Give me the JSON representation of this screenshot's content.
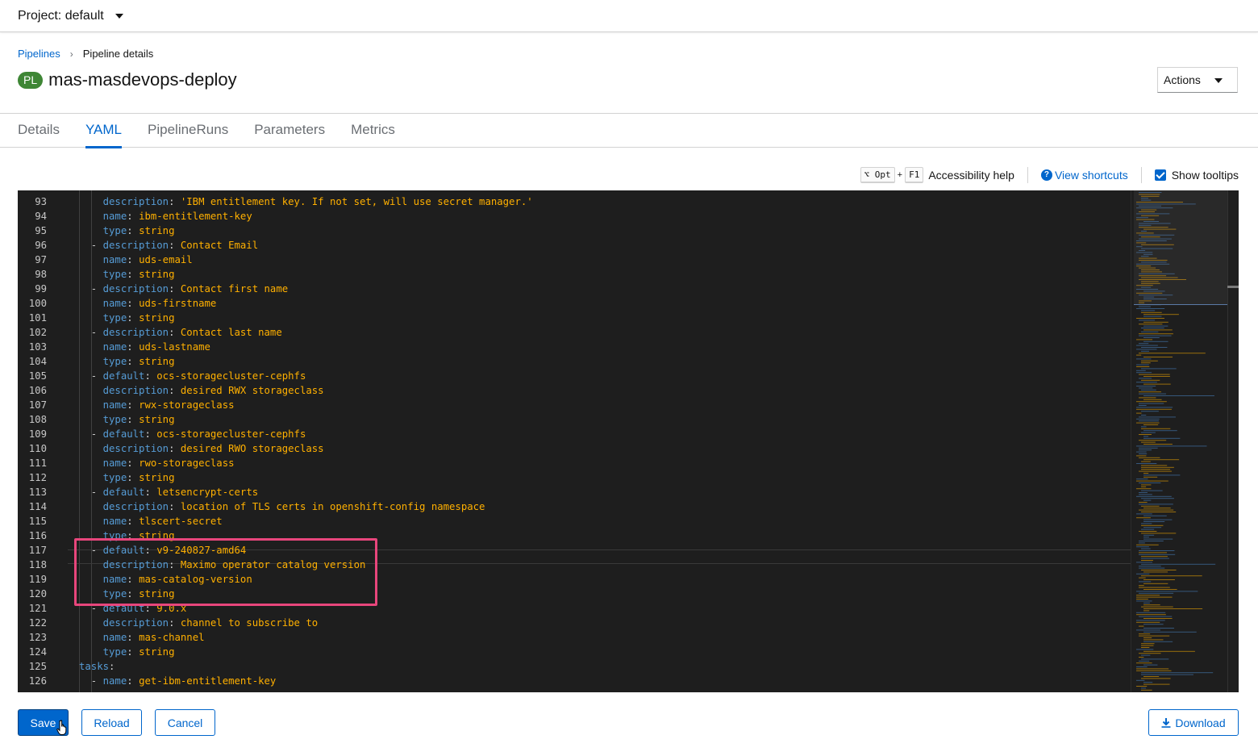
{
  "project": {
    "label": "Project: default"
  },
  "breadcrumb": {
    "parent": "Pipelines",
    "current": "Pipeline details"
  },
  "header": {
    "badge": "PL",
    "title": "mas-masdevops-deploy",
    "actions_label": "Actions"
  },
  "tabs": [
    {
      "label": "Details"
    },
    {
      "label": "YAML",
      "active": true
    },
    {
      "label": "PipelineRuns"
    },
    {
      "label": "Parameters"
    },
    {
      "label": "Metrics"
    }
  ],
  "toolbar": {
    "opt_key": "⌥ Opt",
    "plus": "+",
    "f1_key": "F1",
    "accessibility_help": "Accessibility help",
    "view_shortcuts": "View shortcuts",
    "show_tooltips": "Show tooltips",
    "show_tooltips_checked": true
  },
  "editor": {
    "line_numbers": [
      "93",
      "94",
      "95",
      "96",
      "97",
      "98",
      "99",
      "100",
      "101",
      "102",
      "103",
      "104",
      "105",
      "106",
      "107",
      "108",
      "109",
      "110",
      "111",
      "112",
      "113",
      "114",
      "115",
      "116",
      "117",
      "118",
      "119",
      "120",
      "121",
      "122",
      "123",
      "124",
      "125",
      "126"
    ],
    "lines": [
      {
        "dash": "",
        "key": "description",
        "value": "'IBM entitlement key. If not set, will use secret manager.'"
      },
      {
        "dash": "",
        "key": "name",
        "value": "ibm-entitlement-key"
      },
      {
        "dash": "",
        "key": "type",
        "value": "string"
      },
      {
        "dash": "-",
        "key": "description",
        "value": "Contact Email"
      },
      {
        "dash": "",
        "key": "name",
        "value": "uds-email"
      },
      {
        "dash": "",
        "key": "type",
        "value": "string"
      },
      {
        "dash": "-",
        "key": "description",
        "value": "Contact first name"
      },
      {
        "dash": "",
        "key": "name",
        "value": "uds-firstname"
      },
      {
        "dash": "",
        "key": "type",
        "value": "string"
      },
      {
        "dash": "-",
        "key": "description",
        "value": "Contact last name"
      },
      {
        "dash": "",
        "key": "name",
        "value": "uds-lastname"
      },
      {
        "dash": "",
        "key": "type",
        "value": "string"
      },
      {
        "dash": "-",
        "key": "default",
        "value": "ocs-storagecluster-cephfs"
      },
      {
        "dash": "",
        "key": "description",
        "value": "desired RWX storageclass"
      },
      {
        "dash": "",
        "key": "name",
        "value": "rwx-storageclass"
      },
      {
        "dash": "",
        "key": "type",
        "value": "string"
      },
      {
        "dash": "-",
        "key": "default",
        "value": "ocs-storagecluster-cephfs"
      },
      {
        "dash": "",
        "key": "description",
        "value": "desired RWO storageclass"
      },
      {
        "dash": "",
        "key": "name",
        "value": "rwo-storageclass"
      },
      {
        "dash": "",
        "key": "type",
        "value": "string"
      },
      {
        "dash": "-",
        "key": "default",
        "value": "letsencrypt-certs"
      },
      {
        "dash": "",
        "key": "description",
        "value": "location of TLS certs in openshift-config namespace"
      },
      {
        "dash": "",
        "key": "name",
        "value": "tlscert-secret"
      },
      {
        "dash": "",
        "key": "type",
        "value": "string"
      },
      {
        "dash": "-",
        "key": "default",
        "value": "v9-240827-amd64"
      },
      {
        "dash": "",
        "key": "description",
        "value": "Maximo operator catalog version"
      },
      {
        "dash": "",
        "key": "name",
        "value": "mas-catalog-version"
      },
      {
        "dash": "",
        "key": "type",
        "value": "string"
      },
      {
        "dash": "-",
        "key": "default",
        "value": "9.0.x"
      },
      {
        "dash": "",
        "key": "description",
        "value": "channel to subscribe to"
      },
      {
        "dash": "",
        "key": "name",
        "value": "mas-channel"
      },
      {
        "dash": "",
        "key": "type",
        "value": "string"
      },
      {
        "dash": "",
        "key": "tasks",
        "value": "",
        "top": true
      },
      {
        "dash": "-",
        "key": "name",
        "value": "get-ibm-entitlement-key"
      }
    ]
  },
  "buttons": {
    "save": "Save",
    "reload": "Reload",
    "cancel": "Cancel",
    "download": "Download"
  },
  "colors": {
    "accent": "#0066cc",
    "badge": "#3e8635",
    "highlight": "#e8467c",
    "yaml_key": "#569cd6",
    "yaml_value": "#ffb000"
  },
  "icons": {
    "help": "question-circle-icon",
    "download": "download-icon",
    "breadcrumb_sep": "chevron-right-icon"
  }
}
